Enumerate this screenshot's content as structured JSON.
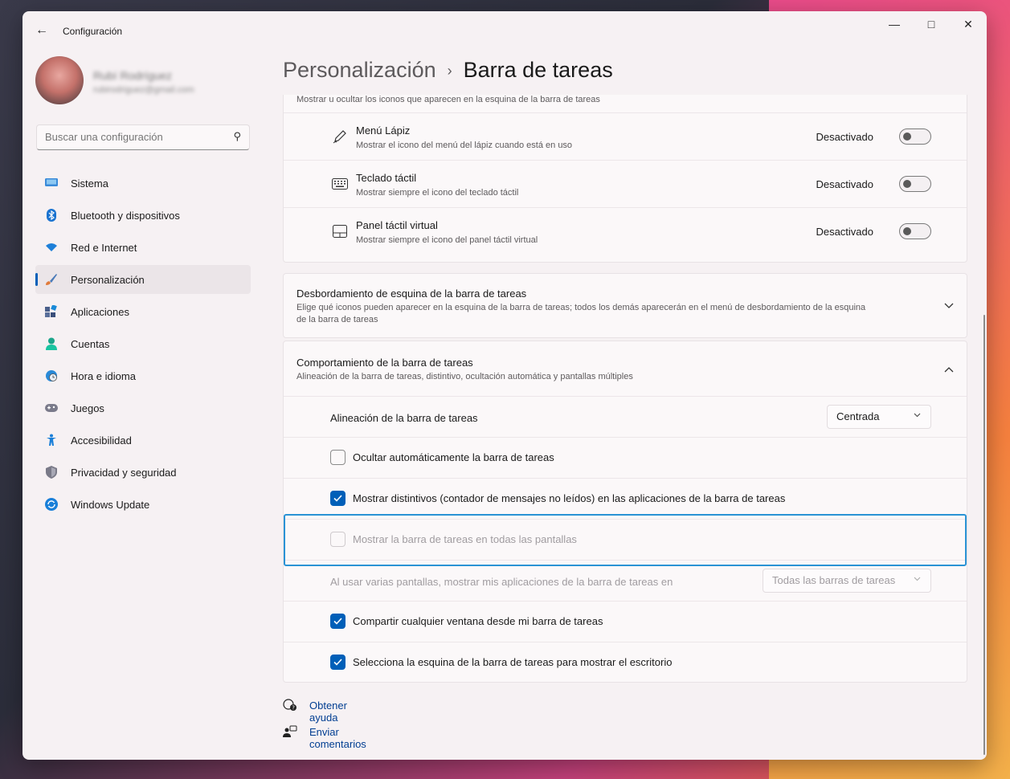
{
  "window": {
    "title": "Configuración",
    "back_icon": "arrow-left-icon",
    "controls": [
      "minimize-icon",
      "maximize-icon",
      "close-icon"
    ]
  },
  "profile": {
    "name": "Rubí Rodríguez",
    "email": "rubirodriguez@gmail.com"
  },
  "search": {
    "placeholder": "Buscar una configuración"
  },
  "nav": {
    "items": [
      {
        "label": "Sistema",
        "icon": "monitor-icon",
        "color": "#3a8ad8"
      },
      {
        "label": "Bluetooth y dispositivos",
        "icon": "bluetooth-icon",
        "color": "#1a73d0"
      },
      {
        "label": "Red e Internet",
        "icon": "wifi-icon",
        "color": "#1d7fd8"
      },
      {
        "label": "Personalización",
        "icon": "brush-icon",
        "color": "#e07a3a",
        "active": true
      },
      {
        "label": "Aplicaciones",
        "icon": "apps-icon",
        "color": "#4a5f8a"
      },
      {
        "label": "Cuentas",
        "icon": "person-icon",
        "color": "#1ba58a"
      },
      {
        "label": "Hora e idioma",
        "icon": "clock-globe-icon",
        "color": "#2a8ad8"
      },
      {
        "label": "Juegos",
        "icon": "gamepad-icon",
        "color": "#6a6a7a"
      },
      {
        "label": "Accesibilidad",
        "icon": "accessibility-icon",
        "color": "#1a7fd8"
      },
      {
        "label": "Privacidad y seguridad",
        "icon": "shield-icon",
        "color": "#6a6a7a"
      },
      {
        "label": "Windows Update",
        "icon": "refresh-icon",
        "color": "#1a7fd8"
      }
    ]
  },
  "breadcrumb": {
    "parent": "Personalización",
    "separator": "›",
    "current": "Barra de tareas"
  },
  "corner_icons": {
    "subtitle": "Mostrar u ocultar los iconos que aparecen en la esquina de la barra de tareas",
    "items": [
      {
        "title": "Menú Lápiz",
        "subtitle": "Mostrar el icono del menú del lápiz cuando está en uso",
        "state": "Desactivado",
        "icon": "pen-icon"
      },
      {
        "title": "Teclado táctil",
        "subtitle": "Mostrar siempre el icono del teclado táctil",
        "state": "Desactivado",
        "icon": "keyboard-icon"
      },
      {
        "title": "Panel táctil virtual",
        "subtitle": "Mostrar siempre el icono del panel táctil virtual",
        "state": "Desactivado",
        "icon": "touchpad-icon"
      }
    ]
  },
  "overflow": {
    "title": "Desbordamiento de esquina de la barra de tareas",
    "subtitle_line1": "Elige qué iconos pueden aparecer en la esquina de la barra de tareas; todos los demás aparecerán en el menú de desbordamiento de la esquina",
    "subtitle_line2": "de la barra de tareas"
  },
  "behavior": {
    "title": "Comportamiento de la barra de tareas",
    "subtitle": "Alineación de la barra de tareas, distintivo, ocultación automática y pantallas múltiples",
    "alignment_label": "Alineación de la barra de tareas",
    "alignment_value": "Centrada",
    "autohide_label": "Ocultar automáticamente la barra de tareas",
    "badges_label": "Mostrar distintivos (contador de mensajes no leídos) en las aplicaciones de la barra de tareas",
    "all_displays_label": "Mostrar la barra de tareas en todas las pantallas",
    "multi_display_label": "Al usar varias pantallas, mostrar mis aplicaciones de la barra de tareas en",
    "multi_display_value": "Todas las barras de tareas",
    "share_window_label": "Compartir cualquier ventana desde mi barra de tareas",
    "corner_desktop_label": "Selecciona la esquina de la barra de tareas para mostrar el escritorio"
  },
  "links": {
    "help": "Obtener ayuda",
    "feedback": "Enviar comentarios"
  }
}
